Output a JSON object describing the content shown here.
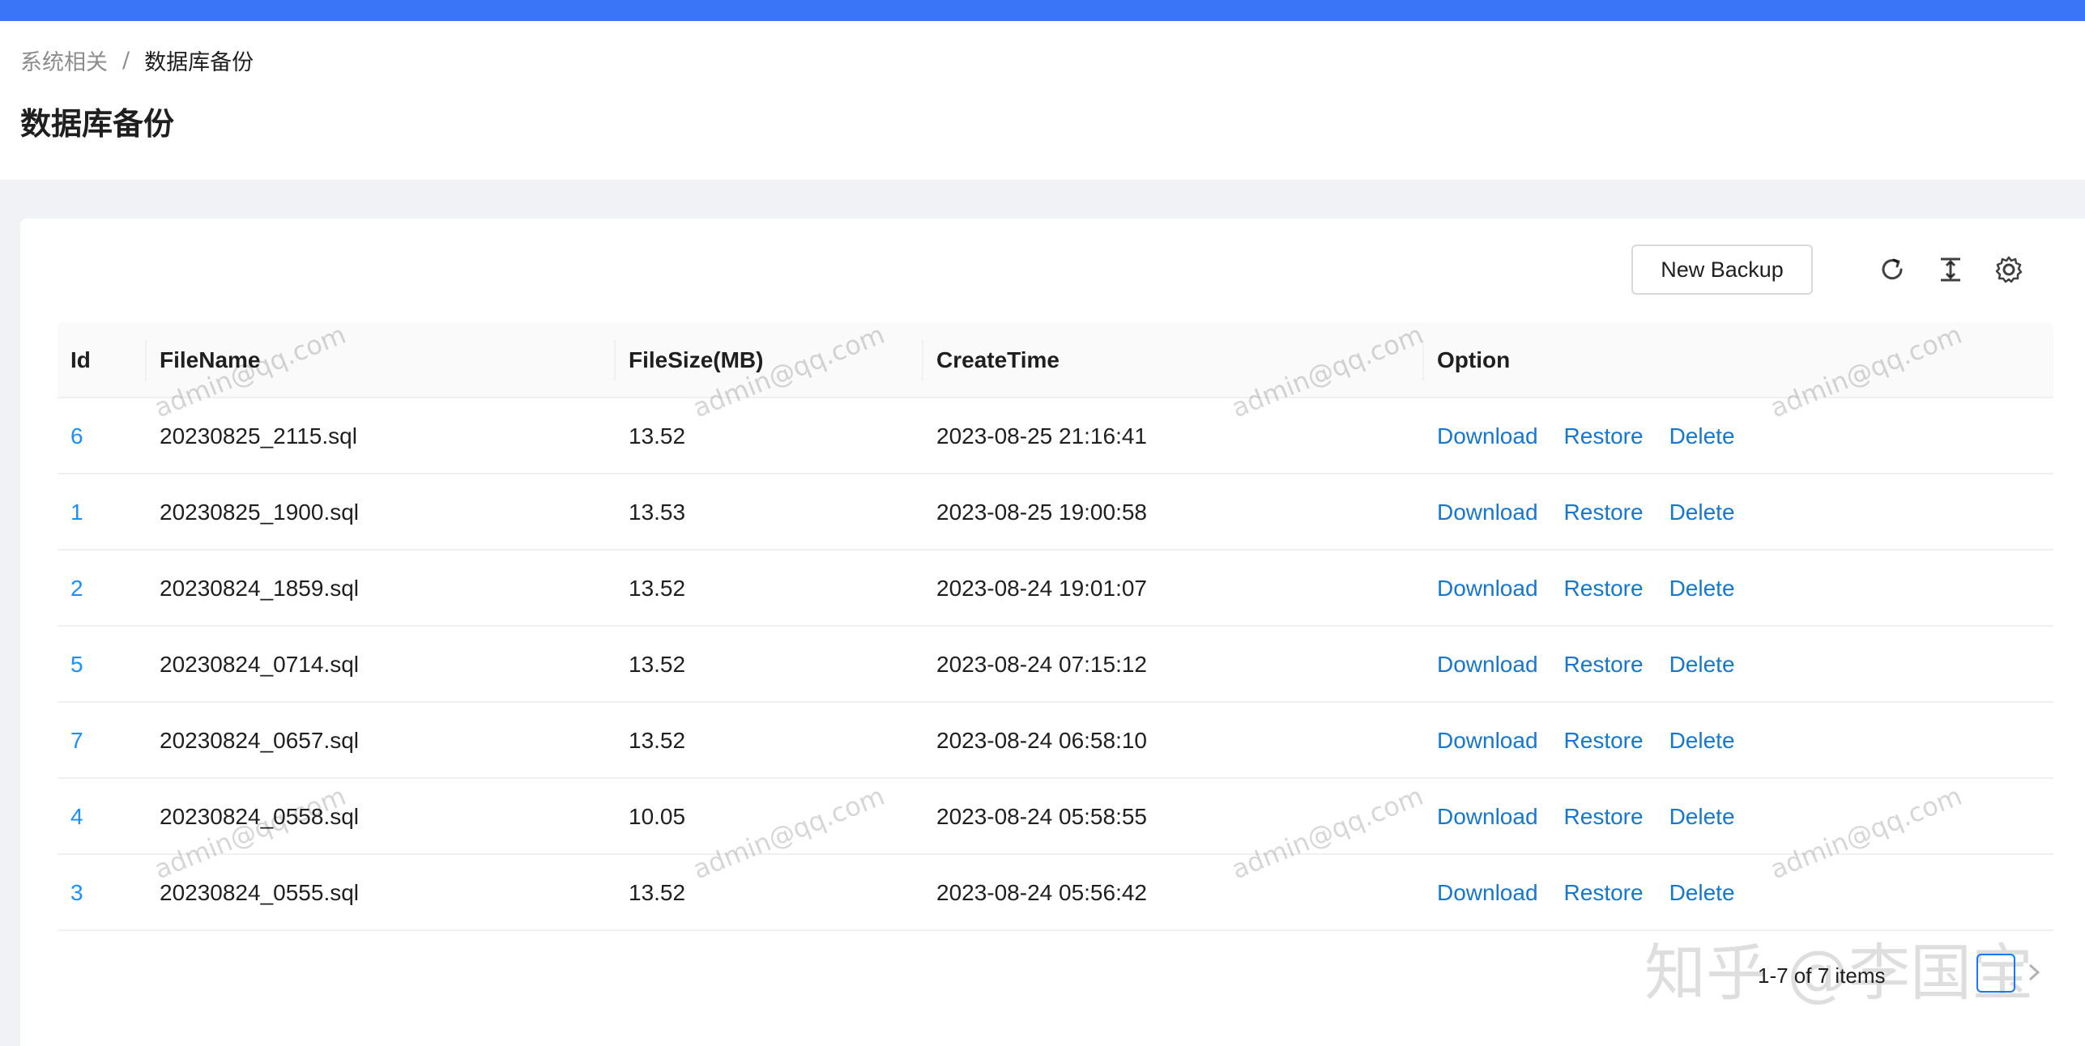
{
  "breadcrumb": {
    "parent": "系统相关",
    "separator": "/",
    "current": "数据库备份"
  },
  "page_title": "数据库备份",
  "toolbar": {
    "new_backup_label": "New Backup"
  },
  "icons": {
    "reload": "reload-icon",
    "density": "column-height-icon",
    "settings": "setting-icon",
    "next": "chevron-right-icon"
  },
  "colors": {
    "topbar": "#3a74f7",
    "link": "#1677cf",
    "id_link": "#1890ff"
  },
  "table": {
    "columns": [
      "Id",
      "FileName",
      "FileSize(MB)",
      "CreateTime",
      "Option"
    ],
    "rows": [
      {
        "id": "6",
        "filename": "20230825_2115.sql",
        "size": "13.52",
        "time": "2023-08-25 21:16:41"
      },
      {
        "id": "1",
        "filename": "20230825_1900.sql",
        "size": "13.53",
        "time": "2023-08-25 19:00:58"
      },
      {
        "id": "2",
        "filename": "20230824_1859.sql",
        "size": "13.52",
        "time": "2023-08-24 19:01:07"
      },
      {
        "id": "5",
        "filename": "20230824_0714.sql",
        "size": "13.52",
        "time": "2023-08-24 07:15:12"
      },
      {
        "id": "7",
        "filename": "20230824_0657.sql",
        "size": "13.52",
        "time": "2023-08-24 06:58:10"
      },
      {
        "id": "4",
        "filename": "20230824_0558.sql",
        "size": "10.05",
        "time": "2023-08-24 05:58:55"
      },
      {
        "id": "3",
        "filename": "20230824_0555.sql",
        "size": "13.52",
        "time": "2023-08-24 05:56:42"
      }
    ],
    "options": {
      "download": "Download",
      "restore": "Restore",
      "delete": "Delete"
    }
  },
  "pagination": {
    "summary": "1-7 of 7 items"
  },
  "watermark_text": "admin@qq.com",
  "brand_overlay": "知乎 @李国宝"
}
